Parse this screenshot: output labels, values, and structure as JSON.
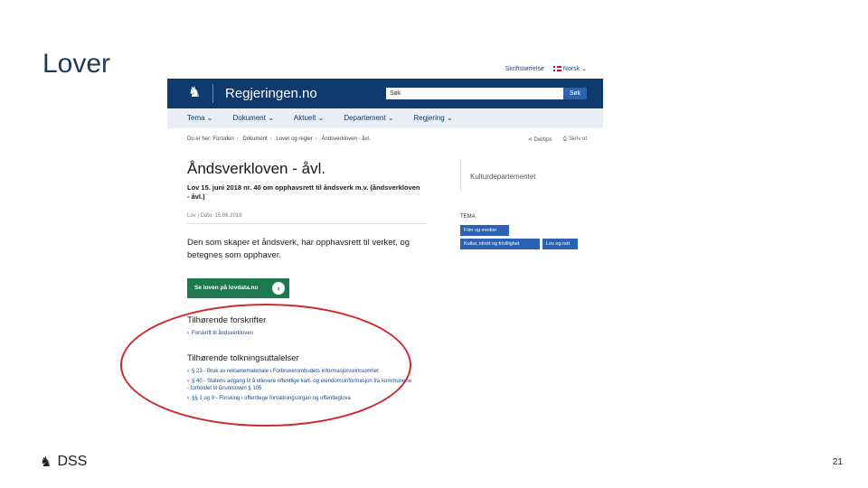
{
  "slide": {
    "title": "Lover",
    "logo_text": "DSS",
    "page_number": "21"
  },
  "site": {
    "top_util": {
      "lang_switch": "Skriftstørrelse",
      "language": "Norsk"
    },
    "brand": "Regjeringen.no",
    "search": {
      "placeholder": "Søk",
      "button": "Søk"
    },
    "nav": [
      "Tema",
      "Dokument",
      "Aktuelt",
      "Departement",
      "Regjering"
    ],
    "breadcrumbs": [
      "Du er her:",
      "Forsiden",
      "Dokument",
      "Lover og regler",
      "Åndsverkloven - åvl."
    ],
    "tools": {
      "share": "Del/tips",
      "print": "Skriv ut"
    }
  },
  "article": {
    "title": "Åndsverkloven - åvl.",
    "subtitle": "Lov 15. juni 2018 nr. 40 om opphavsrett til åndsverk m.v. (åndsverkloven - åvl.)",
    "meta": "Lov | Dato: 15.06.2018",
    "intro": "Den som skaper et åndsverk, har opphavsrett til verket, og betegnes som opphaver.",
    "cta": "Se loven på lovdata.no",
    "forskrifter_heading": "Tilhørende forskrifter",
    "forskrifter": [
      "Forskrift til åndsverkloven"
    ],
    "uttalelser_heading": "Tilhørende tolkningsuttalelser",
    "uttalelser": [
      "§ 23 - Bruk av reklamemateriale i Forbrukerombudets informasjonsvirksomhet",
      "§ 40 - Statens adgang til å utlevere offentlige kart- og eiendomsinformasjon fra kommunene - forholdet til Grunnloven § 105",
      "§§ 1 og 9 - Forsking i offentlege forvaltningsorgan og offentleglova"
    ]
  },
  "sidebar": {
    "department": "Kulturdepartementet",
    "tema_label": "TEMA",
    "tags": [
      "Film og medier",
      "Kultur, idrett og frivillighet",
      "Lov og rett"
    ]
  },
  "colors": {
    "header": "#0f3a6e",
    "accent": "#2c62b4",
    "cta": "#1d7a4f",
    "annotation": "#d0282f"
  }
}
